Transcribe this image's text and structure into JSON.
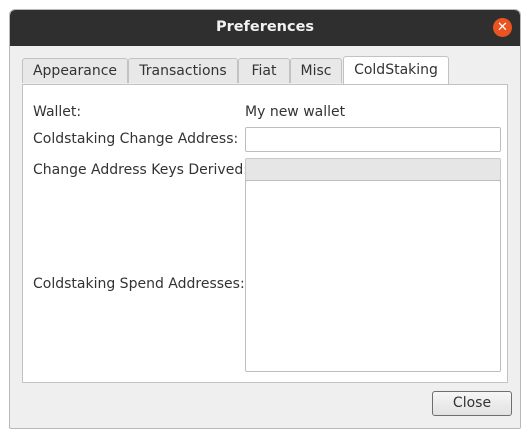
{
  "window": {
    "title": "Preferences"
  },
  "tabs": [
    {
      "label": "Appearance"
    },
    {
      "label": "Transactions"
    },
    {
      "label": "Fiat"
    },
    {
      "label": "Misc"
    },
    {
      "label": "ColdStaking",
      "active": true
    }
  ],
  "coldstaking": {
    "wallet_label": "Wallet:",
    "wallet_value": "My new wallet",
    "change_address_label": "Coldstaking Change Address:",
    "change_address_value": "",
    "keys_derived_label": "Change Address Keys Derived:",
    "keys_derived_value": "",
    "spend_addresses_label": "Coldstaking Spend Addresses:",
    "spend_addresses_value": ""
  },
  "footer": {
    "close_label": "Close"
  },
  "colors": {
    "titlebar": "#2f2f2f",
    "close_icon_bg": "#e95420",
    "window_bg": "#efefef"
  },
  "icons": {
    "window_close": "close-icon"
  }
}
